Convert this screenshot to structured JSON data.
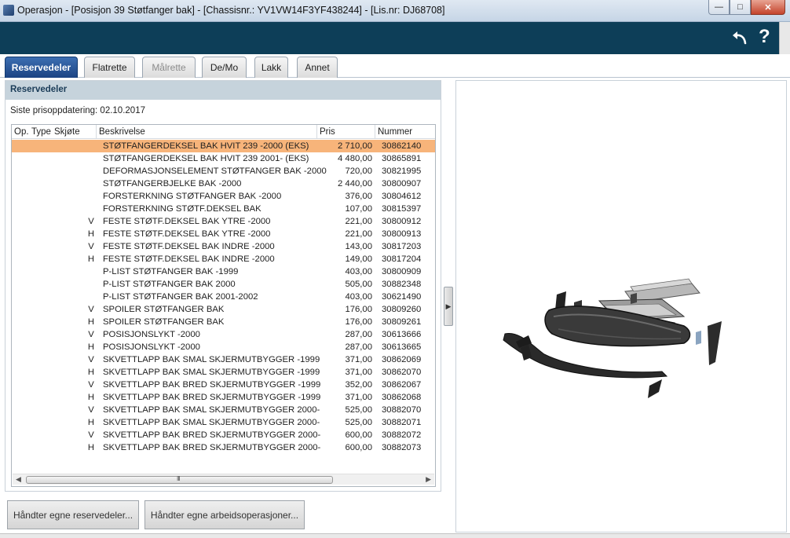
{
  "window": {
    "title": "Operasjon - [Posisjon 39 Støtfanger bak] - [Chassisnr.: YV1VW14F3YF438244] - [Lis.nr: DJ68708]"
  },
  "header": {
    "undo_icon": "undo-arrow-icon",
    "help_label": "?"
  },
  "tabs": [
    {
      "label": "Reservedeler",
      "state": "active"
    },
    {
      "label": "Flatrette",
      "state": "normal"
    },
    {
      "label": "Målrette",
      "state": "disabled"
    },
    {
      "label": "De/Mo",
      "state": "normal"
    },
    {
      "label": "Lakk",
      "state": "normal"
    },
    {
      "label": "Annet",
      "state": "normal"
    }
  ],
  "parts_panel": {
    "title": "Reservedeler",
    "price_update": "Siste prisoppdatering: 02.10.2017",
    "columns": [
      "Op.",
      "Type",
      "Skjøte",
      "Beskrivelse",
      "Pris",
      "Nummer"
    ],
    "rows": [
      {
        "joint": "",
        "description": "STØTFANGERDEKSEL BAK HVIT 239 -2000 (EKS)",
        "price": "2 710,00",
        "number": "30862140"
      },
      {
        "joint": "",
        "description": "STØTFANGERDEKSEL BAK HVIT 239 2001- (EKS)",
        "price": "4 480,00",
        "number": "30865891"
      },
      {
        "joint": "",
        "description": "DEFORMASJONSELEMENT STØTFANGER BAK -2000",
        "price": "720,00",
        "number": "30821995"
      },
      {
        "joint": "",
        "description": "STØTFANGERBJELKE BAK -2000",
        "price": "2 440,00",
        "number": "30800907"
      },
      {
        "joint": "",
        "description": "FORSTERKNING STØTFANGER BAK -2000",
        "price": "376,00",
        "number": "30804612"
      },
      {
        "joint": "",
        "description": "FORSTERKNING STØTF.DEKSEL BAK",
        "price": "107,00",
        "number": "30815397"
      },
      {
        "joint": "V",
        "description": "FESTE STØTF.DEKSEL BAK YTRE -2000",
        "price": "221,00",
        "number": "30800912"
      },
      {
        "joint": "H",
        "description": "FESTE STØTF.DEKSEL BAK YTRE -2000",
        "price": "221,00",
        "number": "30800913"
      },
      {
        "joint": "V",
        "description": "FESTE STØTF.DEKSEL BAK INDRE -2000",
        "price": "143,00",
        "number": "30817203"
      },
      {
        "joint": "H",
        "description": "FESTE STØTF.DEKSEL BAK INDRE -2000",
        "price": "149,00",
        "number": "30817204"
      },
      {
        "joint": "",
        "description": "P-LIST STØTFANGER BAK -1999",
        "price": "403,00",
        "number": "30800909"
      },
      {
        "joint": "",
        "description": "P-LIST STØTFANGER BAK 2000",
        "price": "505,00",
        "number": "30882348"
      },
      {
        "joint": "",
        "description": "P-LIST STØTFANGER BAK 2001-2002",
        "price": "403,00",
        "number": "30621490"
      },
      {
        "joint": "V",
        "description": "SPOILER STØTFANGER BAK",
        "price": "176,00",
        "number": "30809260"
      },
      {
        "joint": "H",
        "description": "SPOILER STØTFANGER BAK",
        "price": "176,00",
        "number": "30809261"
      },
      {
        "joint": "V",
        "description": "POSISJONSLYKT -2000",
        "price": "287,00",
        "number": "30613666"
      },
      {
        "joint": "H",
        "description": "POSISJONSLYKT -2000",
        "price": "287,00",
        "number": "30613665"
      },
      {
        "joint": "V",
        "description": "SKVETTLAPP BAK SMAL SKJERMUTBYGGER -1999",
        "price": "371,00",
        "number": "30862069"
      },
      {
        "joint": "H",
        "description": "SKVETTLAPP BAK SMAL SKJERMUTBYGGER -1999",
        "price": "371,00",
        "number": "30862070"
      },
      {
        "joint": "V",
        "description": "SKVETTLAPP BAK BRED SKJERMUTBYGGER -1999",
        "price": "352,00",
        "number": "30862067"
      },
      {
        "joint": "H",
        "description": "SKVETTLAPP BAK BRED SKJERMUTBYGGER -1999",
        "price": "371,00",
        "number": "30862068"
      },
      {
        "joint": "V",
        "description": "SKVETTLAPP BAK SMAL SKJERMUTBYGGER 2000-",
        "price": "525,00",
        "number": "30882070"
      },
      {
        "joint": "H",
        "description": "SKVETTLAPP BAK SMAL SKJERMUTBYGGER 2000-",
        "price": "525,00",
        "number": "30882071"
      },
      {
        "joint": "V",
        "description": "SKVETTLAPP BAK BRED SKJERMUTBYGGER 2000-",
        "price": "600,00",
        "number": "30882072"
      },
      {
        "joint": "H",
        "description": "SKVETTLAPP BAK BRED SKJERMUTBYGGER 2000-",
        "price": "600,00",
        "number": "30882073"
      }
    ],
    "selected_row": 0,
    "scroll_grip": "III"
  },
  "buttons": {
    "own_parts": "Håndter egne reservedeler...",
    "own_operations": "Håndter egne arbeidsoperasjoner..."
  },
  "colors": {
    "header": "#0d3e58",
    "active_tab": "#1b4383",
    "selected_row": "#f7b47a"
  }
}
